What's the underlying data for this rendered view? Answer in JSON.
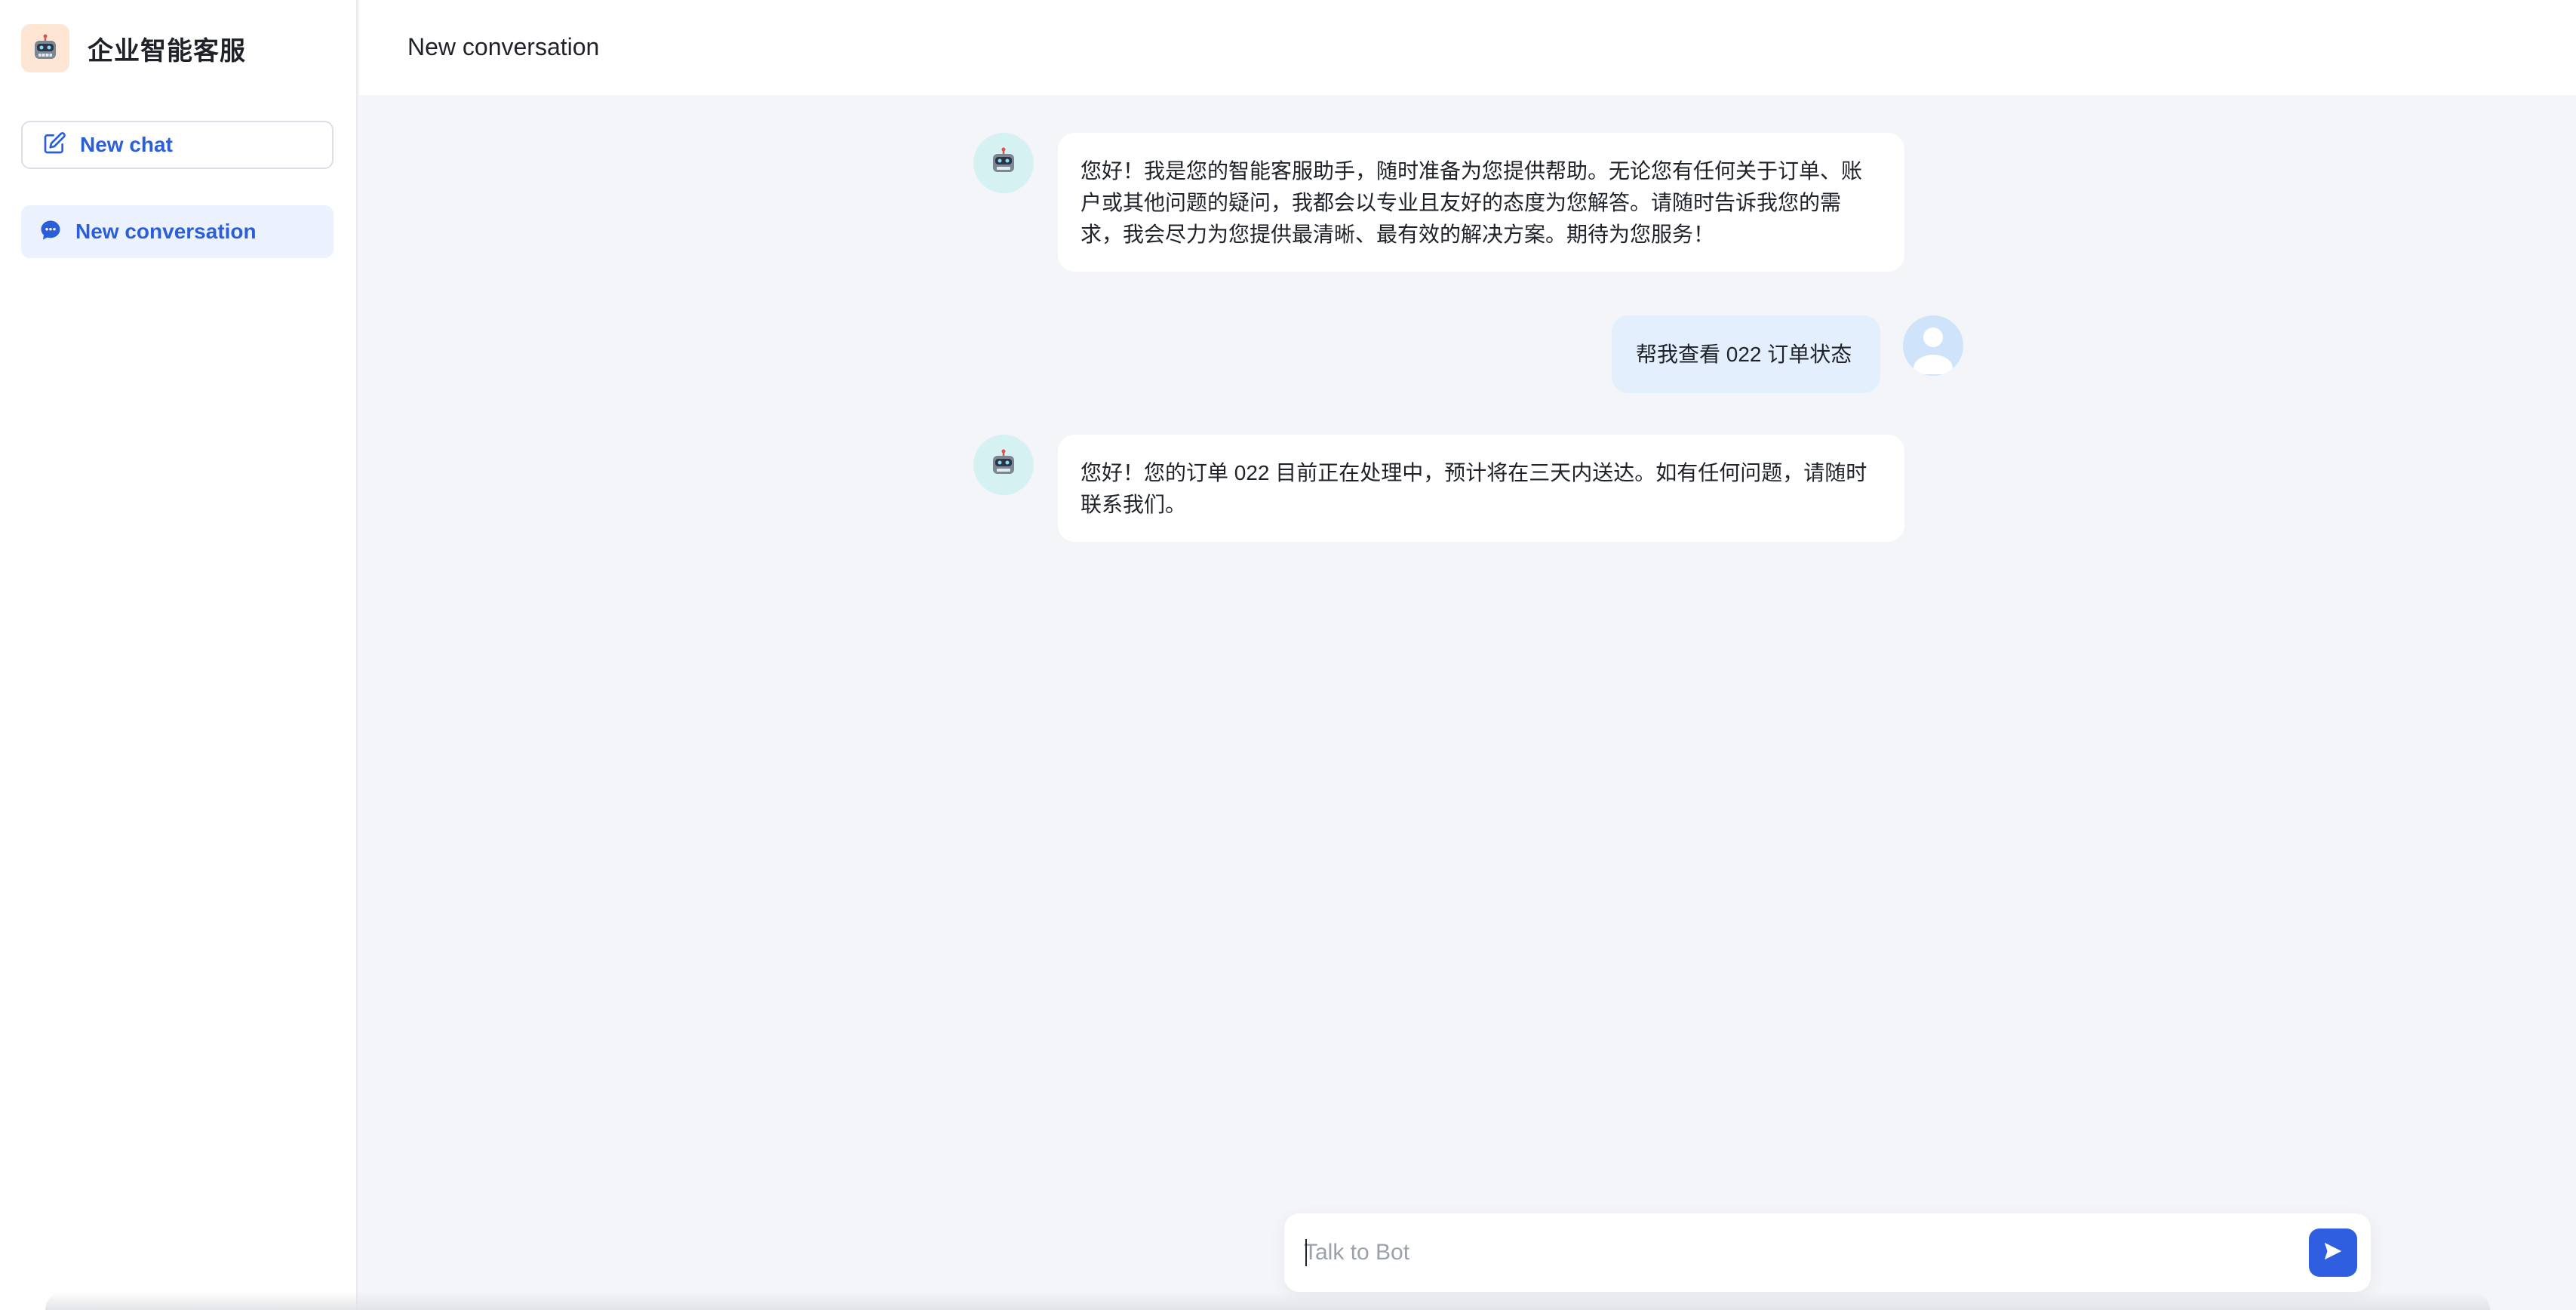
{
  "app": {
    "name": "企业智能客服"
  },
  "sidebar": {
    "new_chat_label": "New chat",
    "conversations": [
      {
        "label": "New conversation",
        "active": true
      }
    ]
  },
  "header": {
    "title": "New conversation"
  },
  "messages": [
    {
      "role": "bot",
      "lines": [
        "您好！我是您的智能客服助手，随时准备为您提供帮助。无论您有任何关于订单、账",
        "户或其他问题的疑问，我都会以专业且友好的态度为您解答。请随时告诉我您的需",
        "求，我会尽力为您提供最清晰、最有效的解决方案。期待为您服务！"
      ]
    },
    {
      "role": "user",
      "lines": [
        "帮我查看 022 订单状态"
      ]
    },
    {
      "role": "bot",
      "lines": [
        "您好！您的订单 022 目前正在处理中，预计将在三天内送达。如有任何问题，请随时",
        "联系我们。"
      ]
    }
  ],
  "composer": {
    "placeholder": "Talk to Bot",
    "value": ""
  },
  "colors": {
    "accent": "#2f5fe0",
    "accent_text": "#2b5fd9",
    "active_bg": "#ebf1fd",
    "user_bubble": "#e3effd",
    "bot_avatar_bg": "#d6f1f2",
    "canvas": "#f4f5f8"
  },
  "icons": {
    "brand": "robot-icon",
    "new_chat": "edit-icon",
    "conversation": "chat-bubble-icon",
    "bot_avatar": "robot-icon",
    "user_avatar": "user-icon",
    "send": "send-icon"
  }
}
